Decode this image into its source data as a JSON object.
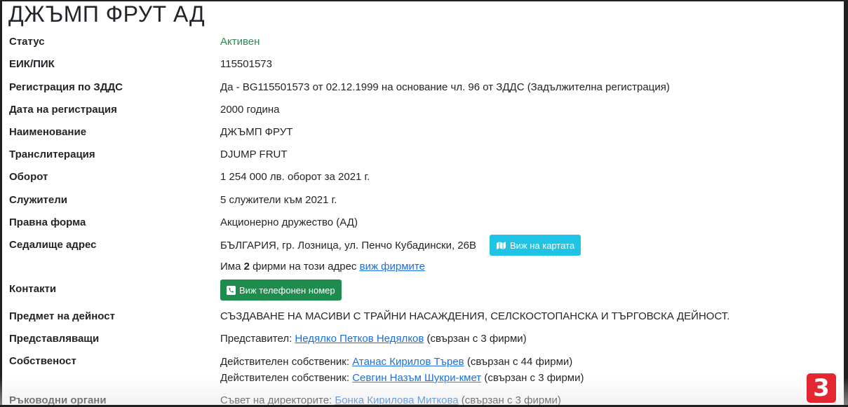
{
  "company": {
    "title": "ДЖЪМП ФРУТ АД"
  },
  "rows": {
    "status": {
      "label": "Статус",
      "value": "Активен"
    },
    "eik": {
      "label": "ЕИК/ПИК",
      "value": "115501573"
    },
    "vat": {
      "label": "Регистрация по ЗДДС",
      "value": "Да - BG115501573 от 02.12.1999 на основание чл. 96 от ЗДДС (Задължителна регистрация)"
    },
    "reg_date": {
      "label": "Дата на регистрация",
      "value": "2000 година"
    },
    "name": {
      "label": "Наименование",
      "value": "ДЖЪМП ФРУТ"
    },
    "translit": {
      "label": "Транслитерация",
      "value": "DJUMP FRUT"
    },
    "turnover": {
      "label": "Оборот",
      "value": "1 254 000 лв. оборот за 2021 г."
    },
    "employees": {
      "label": "Служители",
      "value": "5 служители към 2021 г."
    },
    "legal_form": {
      "label": "Правна форма",
      "value": "Акционерно дружество (АД)"
    },
    "address": {
      "label": "Седалище адрес",
      "value": "БЪЛГАРИЯ, гр. Лозница, ул. Пенчо Кубадински, 26В",
      "map_button": "Виж на картата",
      "firms_prefix": "Има ",
      "firms_count": "2",
      "firms_suffix": " фирми на този адрес ",
      "firms_link": "виж фирмите"
    },
    "contacts": {
      "label": "Контакти",
      "phone_button": "Виж телефонен номер"
    },
    "activity": {
      "label": "Предмет на дейност",
      "value": "СЪЗДАВАНЕ НА МАСИВИ С ТРАЙНИ НАСАЖДЕНИЯ, СЕЛСКОСТОПАНСКА И ТЪРГОВСКА ДЕЙНОСТ."
    },
    "representatives": {
      "label": "Представляващи",
      "prefix": "Представител: ",
      "person": "Недялко Петков Недялков",
      "suffix": " (свързан с 3 фирми)"
    },
    "ownership": {
      "label": "Собственост",
      "items": [
        {
          "prefix": "Действителен собственик: ",
          "person": "Атанас Кирилов Търев",
          "suffix": " (свързан с 44 фирми)"
        },
        {
          "prefix": "Действителен собственик: ",
          "person": "Севгин Назъм Шукри-кмет",
          "suffix": " (свързан с 3 фирми)"
        }
      ]
    },
    "management": {
      "label": "Ръководни органи",
      "prefix": "Съвет на директорите: ",
      "person": "Бонка Кирилова Миткова",
      "suffix": " (свързан с 3 фирми)"
    }
  },
  "logo": {
    "text": "3",
    "color": "#e3262f"
  },
  "colors": {
    "active_status": "#2f8a4e",
    "map_button": "#1fc3e6",
    "phone_button": "#1e8c4d",
    "link": "#1a6fd8"
  },
  "icons": {
    "map_button": "map-icon",
    "phone_button": "phone-icon"
  }
}
